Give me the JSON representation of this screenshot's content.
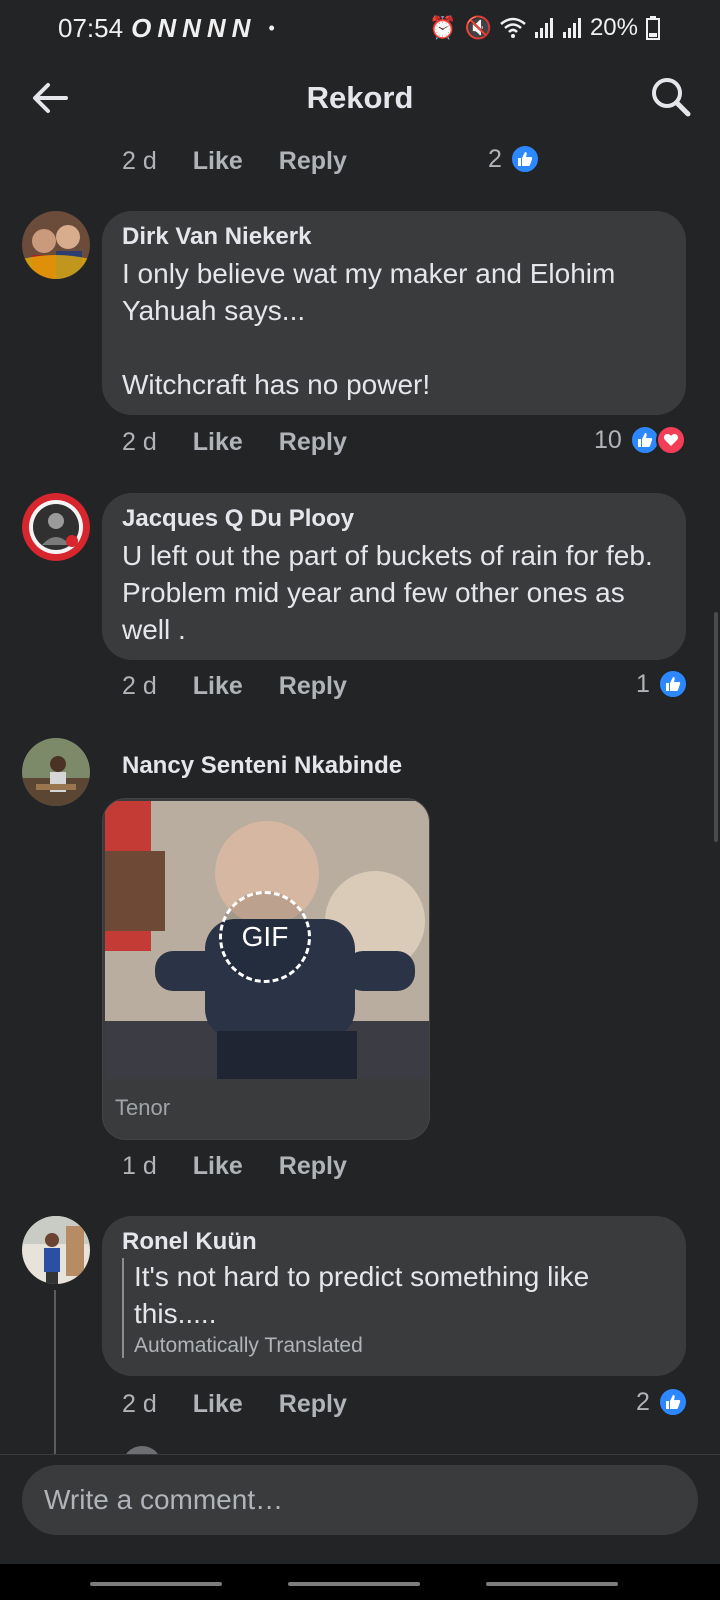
{
  "status_bar": {
    "time": "07:54",
    "notifications": [
      "O",
      "N",
      "N",
      "N",
      "N"
    ],
    "dot": "•",
    "battery": "20%",
    "icons": [
      "alarm-icon",
      "mute-icon",
      "wifi-icon",
      "signal-icon",
      "signal-icon",
      "battery-icon"
    ]
  },
  "header": {
    "title": "Rekord"
  },
  "action_labels": {
    "like": "Like",
    "reply": "Reply"
  },
  "top_actions": {
    "time": "2 d",
    "reactions": "2"
  },
  "comments": [
    {
      "author": "Dirk Van Niekerk",
      "text": "I only believe wat my maker and Elohim Yahuah says...\n\nWitchcraft has no power!",
      "time": "2 d",
      "reactions": "10",
      "reaction_types": [
        "like",
        "love"
      ]
    },
    {
      "author": "Jacques Q Du Plooy",
      "text": "U left out the part of buckets of rain for feb. Problem mid year and few other ones as well .",
      "time": "2 d",
      "reactions": "1",
      "reaction_types": [
        "like"
      ]
    },
    {
      "author": "Nancy Senteni Nkabinde",
      "gif_badge": "GIF",
      "gif_source": "Tenor",
      "time": "1 d"
    },
    {
      "author": "Ronel Kuün",
      "text": "It's not hard to predict something like this.....",
      "translated_label": "Automatically Translated",
      "time": "2 d",
      "reactions": "2",
      "reaction_types": [
        "like"
      ]
    }
  ],
  "composer": {
    "placeholder": "Write a comment…"
  },
  "colors": {
    "background": "#232425",
    "bubble": "#3a3b3c",
    "like_blue": "#2d88ff",
    "love_red": "#f33e58"
  }
}
